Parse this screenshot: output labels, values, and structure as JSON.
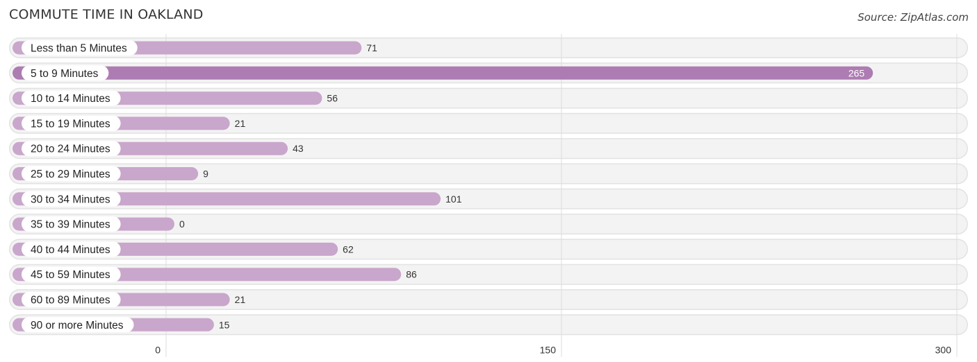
{
  "header": {
    "title": "COMMUTE TIME IN OAKLAND",
    "source": "Source: ZipAtlas.com"
  },
  "colors": {
    "bar": "#c9a6cb",
    "bar_highlight": "#ad7cb2",
    "track": "#f3f3f3",
    "track_border": "#e2e2e2",
    "grid": "#dddddd",
    "label_pill": "#ffffff"
  },
  "chart_data": {
    "type": "bar",
    "orientation": "horizontal",
    "title": "COMMUTE TIME IN OAKLAND",
    "xlabel": "",
    "ylabel": "",
    "categories": [
      "Less than 5 Minutes",
      "5 to 9 Minutes",
      "10 to 14 Minutes",
      "15 to 19 Minutes",
      "20 to 24 Minutes",
      "25 to 29 Minutes",
      "30 to 34 Minutes",
      "35 to 39 Minutes",
      "40 to 44 Minutes",
      "45 to 59 Minutes",
      "60 to 89 Minutes",
      "90 or more Minutes"
    ],
    "values": [
      71,
      265,
      56,
      21,
      43,
      9,
      101,
      0,
      62,
      86,
      21,
      15
    ],
    "highlight_index": 1,
    "xlim": [
      0,
      300
    ],
    "xticks": [
      0,
      150,
      300
    ],
    "xtick_labels": [
      "0",
      "150",
      "300"
    ],
    "grid": true,
    "legend": "none"
  }
}
